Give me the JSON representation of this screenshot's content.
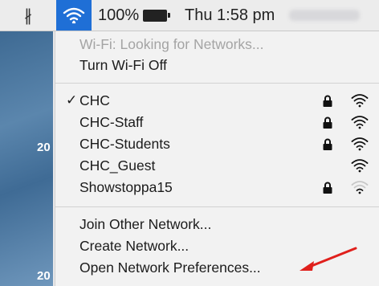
{
  "menubar": {
    "bluetooth_icon": "bluetooth-icon",
    "wifi_icon": "wifi-icon",
    "battery_percent": "100%",
    "clock": "Thu 1:58 pm",
    "accent": "#1f6fd6"
  },
  "desktop": {
    "labels": [
      "20",
      "20"
    ]
  },
  "menu": {
    "status": "Wi-Fi: Looking for Networks...",
    "toggle_label": "Turn Wi-Fi Off",
    "networks": [
      {
        "name": "CHC",
        "connected": true,
        "locked": true,
        "signal": 3
      },
      {
        "name": "CHC-Staff",
        "connected": false,
        "locked": true,
        "signal": 3
      },
      {
        "name": "CHC-Students",
        "connected": false,
        "locked": true,
        "signal": 3
      },
      {
        "name": "CHC_Guest",
        "connected": false,
        "locked": false,
        "signal": 3
      },
      {
        "name": "Showstoppa15",
        "connected": false,
        "locked": true,
        "signal": 1
      }
    ],
    "checkmark": "✓",
    "actions": {
      "join_other": "Join Other Network...",
      "create": "Create Network...",
      "open_prefs": "Open Network Preferences..."
    }
  }
}
